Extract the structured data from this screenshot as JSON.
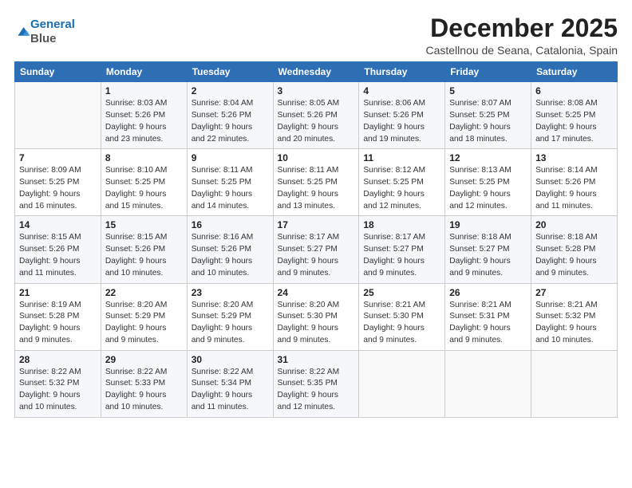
{
  "header": {
    "logo_line1": "General",
    "logo_line2": "Blue",
    "title": "December 2025",
    "subtitle": "Castellnou de Seana, Catalonia, Spain"
  },
  "weekdays": [
    "Sunday",
    "Monday",
    "Tuesday",
    "Wednesday",
    "Thursday",
    "Friday",
    "Saturday"
  ],
  "weeks": [
    [
      {
        "day": "",
        "info": ""
      },
      {
        "day": "1",
        "info": "Sunrise: 8:03 AM\nSunset: 5:26 PM\nDaylight: 9 hours\nand 23 minutes."
      },
      {
        "day": "2",
        "info": "Sunrise: 8:04 AM\nSunset: 5:26 PM\nDaylight: 9 hours\nand 22 minutes."
      },
      {
        "day": "3",
        "info": "Sunrise: 8:05 AM\nSunset: 5:26 PM\nDaylight: 9 hours\nand 20 minutes."
      },
      {
        "day": "4",
        "info": "Sunrise: 8:06 AM\nSunset: 5:26 PM\nDaylight: 9 hours\nand 19 minutes."
      },
      {
        "day": "5",
        "info": "Sunrise: 8:07 AM\nSunset: 5:25 PM\nDaylight: 9 hours\nand 18 minutes."
      },
      {
        "day": "6",
        "info": "Sunrise: 8:08 AM\nSunset: 5:25 PM\nDaylight: 9 hours\nand 17 minutes."
      }
    ],
    [
      {
        "day": "7",
        "info": "Sunrise: 8:09 AM\nSunset: 5:25 PM\nDaylight: 9 hours\nand 16 minutes."
      },
      {
        "day": "8",
        "info": "Sunrise: 8:10 AM\nSunset: 5:25 PM\nDaylight: 9 hours\nand 15 minutes."
      },
      {
        "day": "9",
        "info": "Sunrise: 8:11 AM\nSunset: 5:25 PM\nDaylight: 9 hours\nand 14 minutes."
      },
      {
        "day": "10",
        "info": "Sunrise: 8:11 AM\nSunset: 5:25 PM\nDaylight: 9 hours\nand 13 minutes."
      },
      {
        "day": "11",
        "info": "Sunrise: 8:12 AM\nSunset: 5:25 PM\nDaylight: 9 hours\nand 12 minutes."
      },
      {
        "day": "12",
        "info": "Sunrise: 8:13 AM\nSunset: 5:25 PM\nDaylight: 9 hours\nand 12 minutes."
      },
      {
        "day": "13",
        "info": "Sunrise: 8:14 AM\nSunset: 5:26 PM\nDaylight: 9 hours\nand 11 minutes."
      }
    ],
    [
      {
        "day": "14",
        "info": "Sunrise: 8:15 AM\nSunset: 5:26 PM\nDaylight: 9 hours\nand 11 minutes."
      },
      {
        "day": "15",
        "info": "Sunrise: 8:15 AM\nSunset: 5:26 PM\nDaylight: 9 hours\nand 10 minutes."
      },
      {
        "day": "16",
        "info": "Sunrise: 8:16 AM\nSunset: 5:26 PM\nDaylight: 9 hours\nand 10 minutes."
      },
      {
        "day": "17",
        "info": "Sunrise: 8:17 AM\nSunset: 5:27 PM\nDaylight: 9 hours\nand 9 minutes."
      },
      {
        "day": "18",
        "info": "Sunrise: 8:17 AM\nSunset: 5:27 PM\nDaylight: 9 hours\nand 9 minutes."
      },
      {
        "day": "19",
        "info": "Sunrise: 8:18 AM\nSunset: 5:27 PM\nDaylight: 9 hours\nand 9 minutes."
      },
      {
        "day": "20",
        "info": "Sunrise: 8:18 AM\nSunset: 5:28 PM\nDaylight: 9 hours\nand 9 minutes."
      }
    ],
    [
      {
        "day": "21",
        "info": "Sunrise: 8:19 AM\nSunset: 5:28 PM\nDaylight: 9 hours\nand 9 minutes."
      },
      {
        "day": "22",
        "info": "Sunrise: 8:20 AM\nSunset: 5:29 PM\nDaylight: 9 hours\nand 9 minutes."
      },
      {
        "day": "23",
        "info": "Sunrise: 8:20 AM\nSunset: 5:29 PM\nDaylight: 9 hours\nand 9 minutes."
      },
      {
        "day": "24",
        "info": "Sunrise: 8:20 AM\nSunset: 5:30 PM\nDaylight: 9 hours\nand 9 minutes."
      },
      {
        "day": "25",
        "info": "Sunrise: 8:21 AM\nSunset: 5:30 PM\nDaylight: 9 hours\nand 9 minutes."
      },
      {
        "day": "26",
        "info": "Sunrise: 8:21 AM\nSunset: 5:31 PM\nDaylight: 9 hours\nand 9 minutes."
      },
      {
        "day": "27",
        "info": "Sunrise: 8:21 AM\nSunset: 5:32 PM\nDaylight: 9 hours\nand 10 minutes."
      }
    ],
    [
      {
        "day": "28",
        "info": "Sunrise: 8:22 AM\nSunset: 5:32 PM\nDaylight: 9 hours\nand 10 minutes."
      },
      {
        "day": "29",
        "info": "Sunrise: 8:22 AM\nSunset: 5:33 PM\nDaylight: 9 hours\nand 10 minutes."
      },
      {
        "day": "30",
        "info": "Sunrise: 8:22 AM\nSunset: 5:34 PM\nDaylight: 9 hours\nand 11 minutes."
      },
      {
        "day": "31",
        "info": "Sunrise: 8:22 AM\nSunset: 5:35 PM\nDaylight: 9 hours\nand 12 minutes."
      },
      {
        "day": "",
        "info": ""
      },
      {
        "day": "",
        "info": ""
      },
      {
        "day": "",
        "info": ""
      }
    ]
  ]
}
